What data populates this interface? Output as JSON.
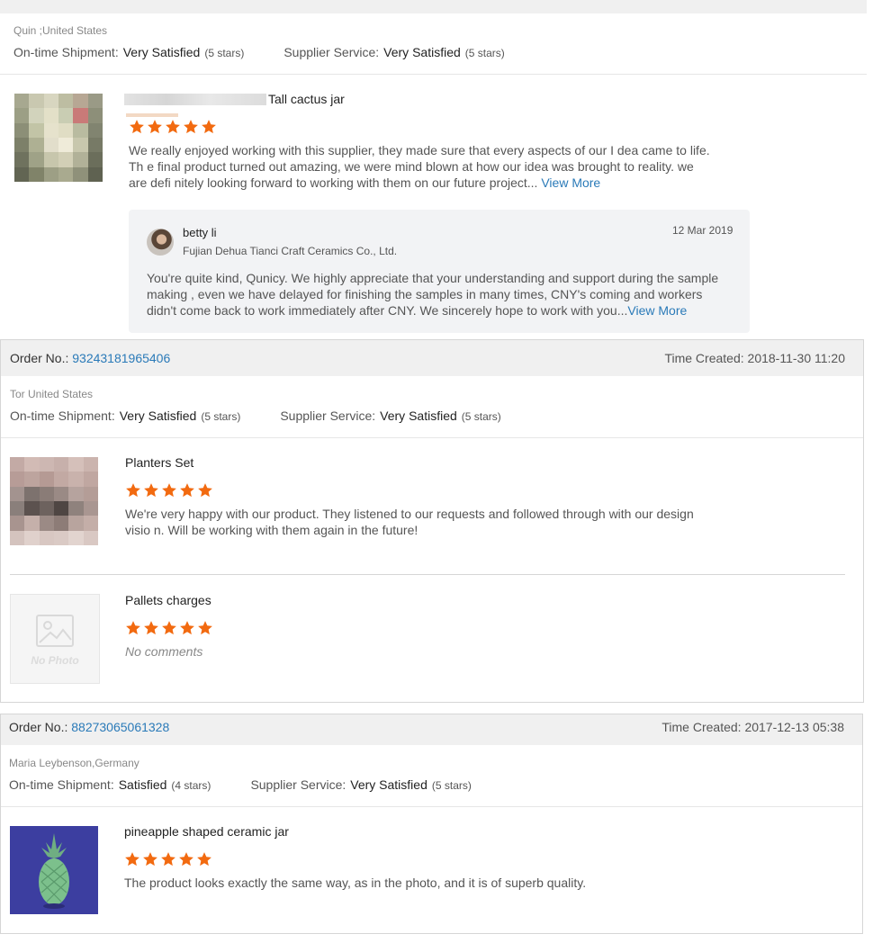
{
  "colors": {
    "star": "#f26a10",
    "link": "#2a7ab8",
    "band": "#f0f0f0"
  },
  "order1": {
    "buyer": "Quin        ;United States",
    "shipment": {
      "label": "On-time Shipment:",
      "value": "Very Satisfied",
      "stars": "(5 stars)"
    },
    "service": {
      "label": "Supplier Service:",
      "value": "Very Satisfied",
      "stars": "(5 stars)"
    },
    "product": {
      "title": "Tall cactus jar",
      "rating": 5,
      "review": "We really enjoyed working with this supplier, they made sure that every aspects of our I dea came to life. Th e final product turned out amazing, we were mind blown at how our idea was brought to reality. we are defi nitely looking forward to working with them on our future project...",
      "view_more": "View More"
    },
    "reply": {
      "name": "betty li",
      "company": "Fujian Dehua Tianci Craft Ceramics Co., Ltd.",
      "date": "12 Mar 2019",
      "text": "You're quite kind, Qunicy. We highly appreciate that your understanding and support during the sample making , even we have delayed for finishing the samples in many times, CNY's coming and workers didn't come back to work immediately after CNY. We sincerely hope to work with you...",
      "view_more": "View More"
    }
  },
  "order2": {
    "order_label": "Order No.:",
    "order_no": "93243181965406",
    "time_label": "Time Created:",
    "time": "2018-11-30 11:20",
    "buyer": "Tor            United States",
    "shipment": {
      "label": "On-time Shipment:",
      "value": "Very Satisfied",
      "stars": "(5 stars)"
    },
    "service": {
      "label": "Supplier Service:",
      "value": "Very Satisfied",
      "stars": "(5 stars)"
    },
    "products": [
      {
        "title": "Planters Set",
        "rating": 5,
        "review": "We're very happy with our product. They listened to our requests and followed through with our design visio n. Will be working with them again in the future!"
      },
      {
        "title": "Pallets charges",
        "rating": 5,
        "review": "No comments",
        "photo_text": "No Photo"
      }
    ]
  },
  "order3": {
    "order_label": "Order No.:",
    "order_no": "88273065061328",
    "time_label": "Time Created:",
    "time": "2017-12-13 05:38",
    "buyer": "Maria Leybenson,Germany",
    "shipment": {
      "label": "On-time Shipment:",
      "value": "Satisfied",
      "stars": "(4 stars)"
    },
    "service": {
      "label": "Supplier Service:",
      "value": "Very Satisfied",
      "stars": "(5 stars)"
    },
    "product": {
      "title": "pineapple shaped ceramic jar",
      "rating": 5,
      "review": "The product looks exactly the same way, as in the photo, and it is of superb quality."
    }
  }
}
